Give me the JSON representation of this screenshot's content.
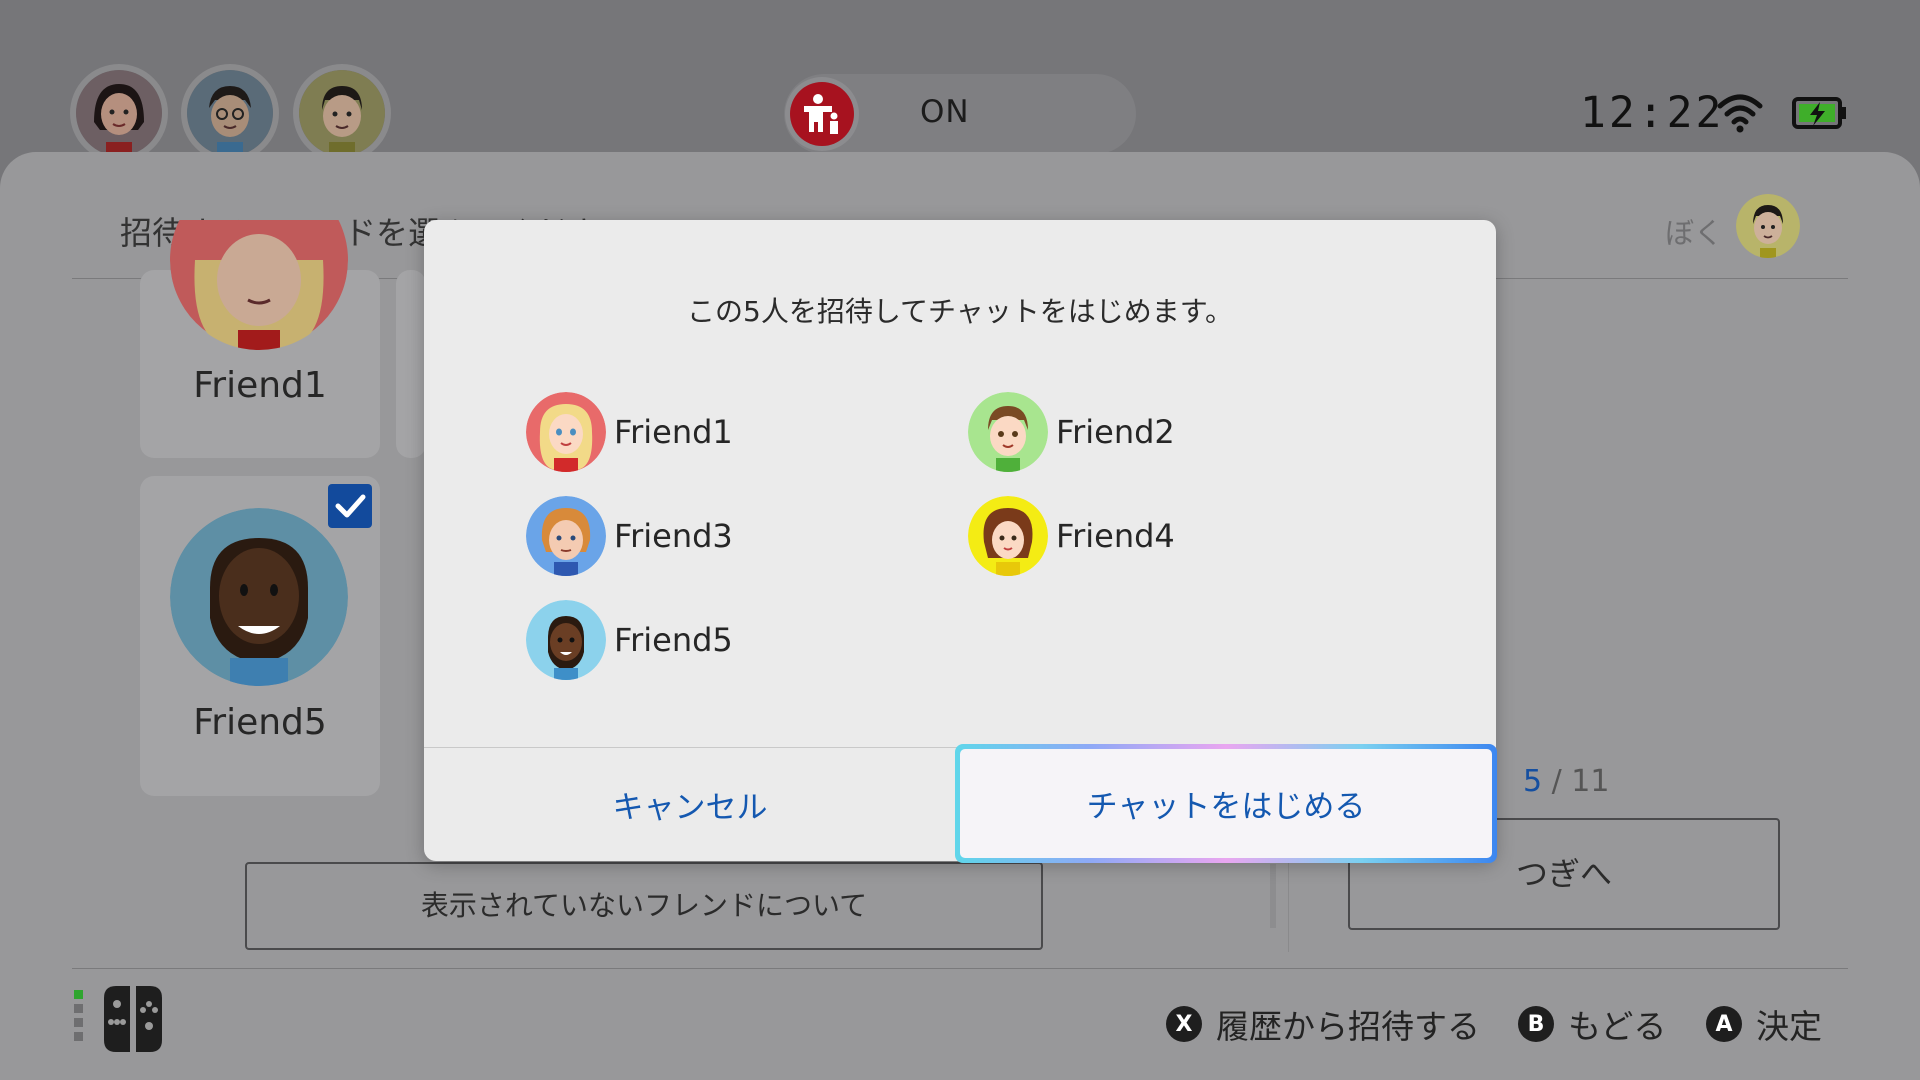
{
  "status_bar": {
    "parental_control_state": "ON",
    "time": "12:22"
  },
  "header": {
    "title": "招待するフレンドを選んでください",
    "current_user_label": "ぼく"
  },
  "cards": [
    {
      "name": "Friend1",
      "selected": false
    },
    {
      "name": "Friend5",
      "selected": true
    }
  ],
  "hidden_friends_button": "表示されていないフレンドについて",
  "counter": {
    "current": "5",
    "separator": "/",
    "total": "11"
  },
  "next_button": "つぎへ",
  "footer": {
    "history_glyph": "X",
    "history_label": "履歴から招待する",
    "back_glyph": "B",
    "back_label": "もどる",
    "confirm_glyph": "A",
    "confirm_label": "決定"
  },
  "dialog": {
    "message": "この5人を招待してチャットをはじめます。",
    "friends": [
      {
        "name": "Friend1",
        "bg": "#e86a6a"
      },
      {
        "name": "Friend2",
        "bg": "#a8e58f"
      },
      {
        "name": "Friend3",
        "bg": "#6aa4e8"
      },
      {
        "name": "Friend4",
        "bg": "#f4ec14"
      },
      {
        "name": "Friend5",
        "bg": "#8cd2ec"
      }
    ],
    "cancel_label": "キャンセル",
    "start_label": "チャットをはじめる"
  },
  "colors": {
    "accent_blue": "#1458b0",
    "checkbox_blue": "#124a9c",
    "parental_red": "#a7121f"
  }
}
